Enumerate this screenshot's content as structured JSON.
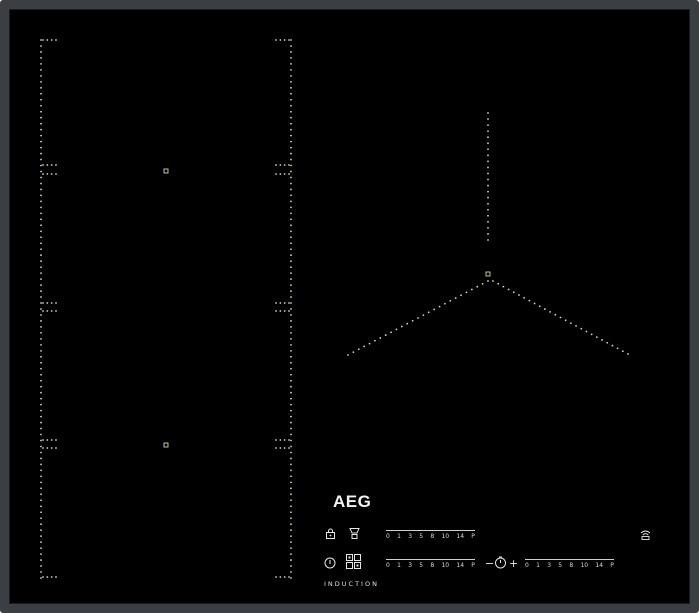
{
  "brand": {
    "logo_text": "AEG",
    "subtitle": "INDUCTION"
  },
  "sliders": {
    "upper_left": {
      "ticks": [
        "0",
        "1",
        "3",
        "5",
        "8",
        "10",
        "14",
        "P"
      ]
    },
    "lower_left": {
      "ticks": [
        "0",
        "1",
        "3",
        "5",
        "8",
        "10",
        "14",
        "P"
      ]
    },
    "lower_right": {
      "ticks": [
        "0",
        "1",
        "3",
        "5",
        "8",
        "10",
        "14",
        "P"
      ]
    }
  },
  "controls": {
    "timer_minus": "−",
    "timer_plus": "+"
  },
  "icons": {
    "lock": "lock-icon",
    "hob2hood": "hood-link-icon",
    "power": "power-icon",
    "menu": "menu-grid-icon",
    "timer": "timer-icon",
    "wifi": "wifi-icon"
  },
  "colors": {
    "glass": "#000000",
    "frame": "#3b3e43",
    "print": "#e6e6e6"
  }
}
